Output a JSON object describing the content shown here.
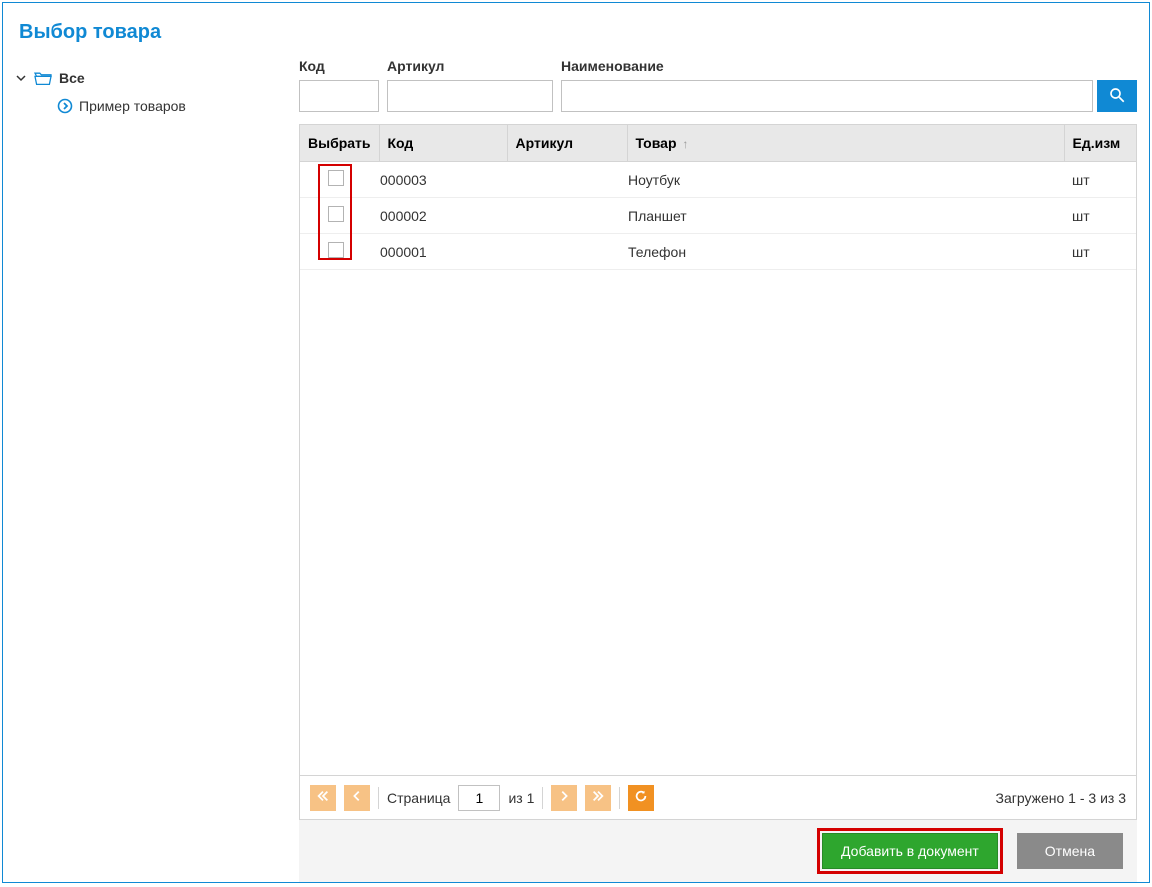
{
  "title": "Выбор товара",
  "tree": {
    "root": "Все",
    "child": "Пример товаров"
  },
  "filters": {
    "code_label": "Код",
    "article_label": "Артикул",
    "name_label": "Наименование"
  },
  "table": {
    "columns": {
      "select": "Выбрать",
      "code": "Код",
      "article": "Артикул",
      "name": "Товар",
      "unit": "Ед.изм"
    },
    "rows": [
      {
        "code": "000003",
        "article": "",
        "name": "Ноутбук",
        "unit": "шт"
      },
      {
        "code": "000002",
        "article": "",
        "name": "Планшет",
        "unit": "шт"
      },
      {
        "code": "000001",
        "article": "",
        "name": "Телефон",
        "unit": "шт"
      }
    ]
  },
  "pager": {
    "page_label": "Страница",
    "page_value": "1",
    "of_label": "из 1",
    "status": "Загружено 1 - 3 из 3"
  },
  "footer": {
    "add": "Добавить в документ",
    "cancel": "Отмена"
  }
}
